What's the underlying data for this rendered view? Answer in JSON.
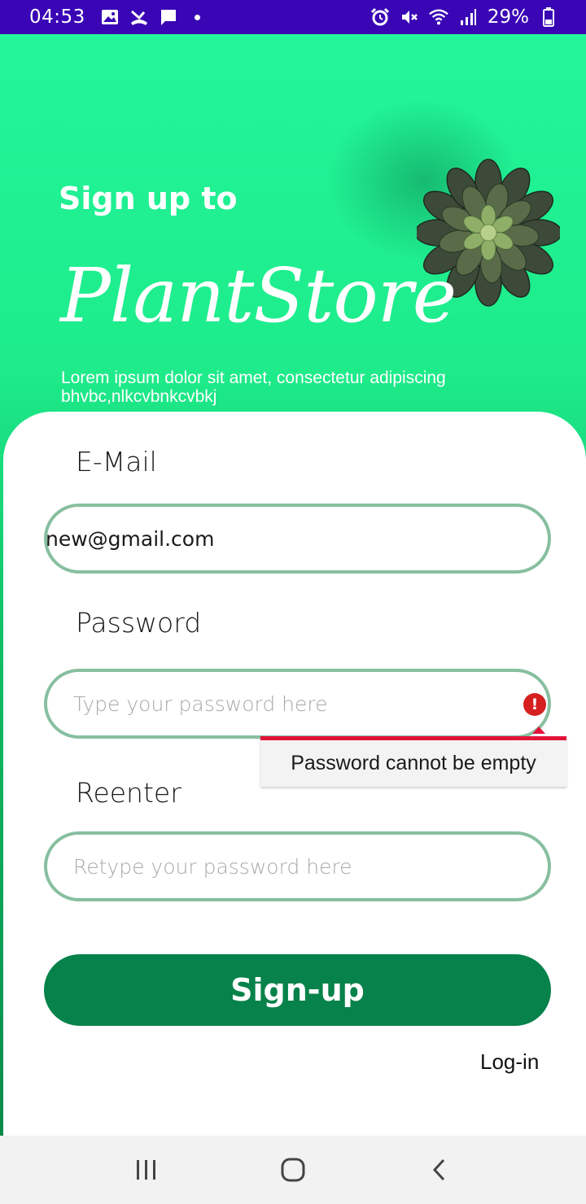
{
  "status_bar": {
    "time": "04:53",
    "battery": "29%",
    "background": "#3a06b5",
    "icons_left": [
      "image-icon",
      "missed-call-icon",
      "chat-icon",
      "dot-icon"
    ],
    "icons_right": [
      "alarm-icon",
      "mute-icon",
      "wifi-icon",
      "signal-icon",
      "battery-icon"
    ]
  },
  "hero": {
    "subtitle": "Sign up to",
    "title": "PlantStore",
    "description": "Lorem ipsum dolor sit amet, consectetur adipiscing bhvbc,nlkcvbnkcvbkj",
    "gradient_top": "#22f59a",
    "gradient_bottom": "#0a8a48"
  },
  "form": {
    "email": {
      "label": "E-Mail",
      "value": "new@gmail.com"
    },
    "password": {
      "label": "Password",
      "value": "",
      "placeholder": "Type your password here",
      "error": "Password cannot be empty"
    },
    "reenter": {
      "label": "Reenter",
      "value": "",
      "placeholder": "Retype your password here"
    },
    "field_border": "#87bfa0",
    "error_color": "#e3143a",
    "submit_label": "Sign-up",
    "submit_color": "#06824a",
    "login_label": "Log-in"
  },
  "nav_bar": {
    "buttons": [
      "recents-icon",
      "home-icon",
      "back-icon"
    ]
  }
}
